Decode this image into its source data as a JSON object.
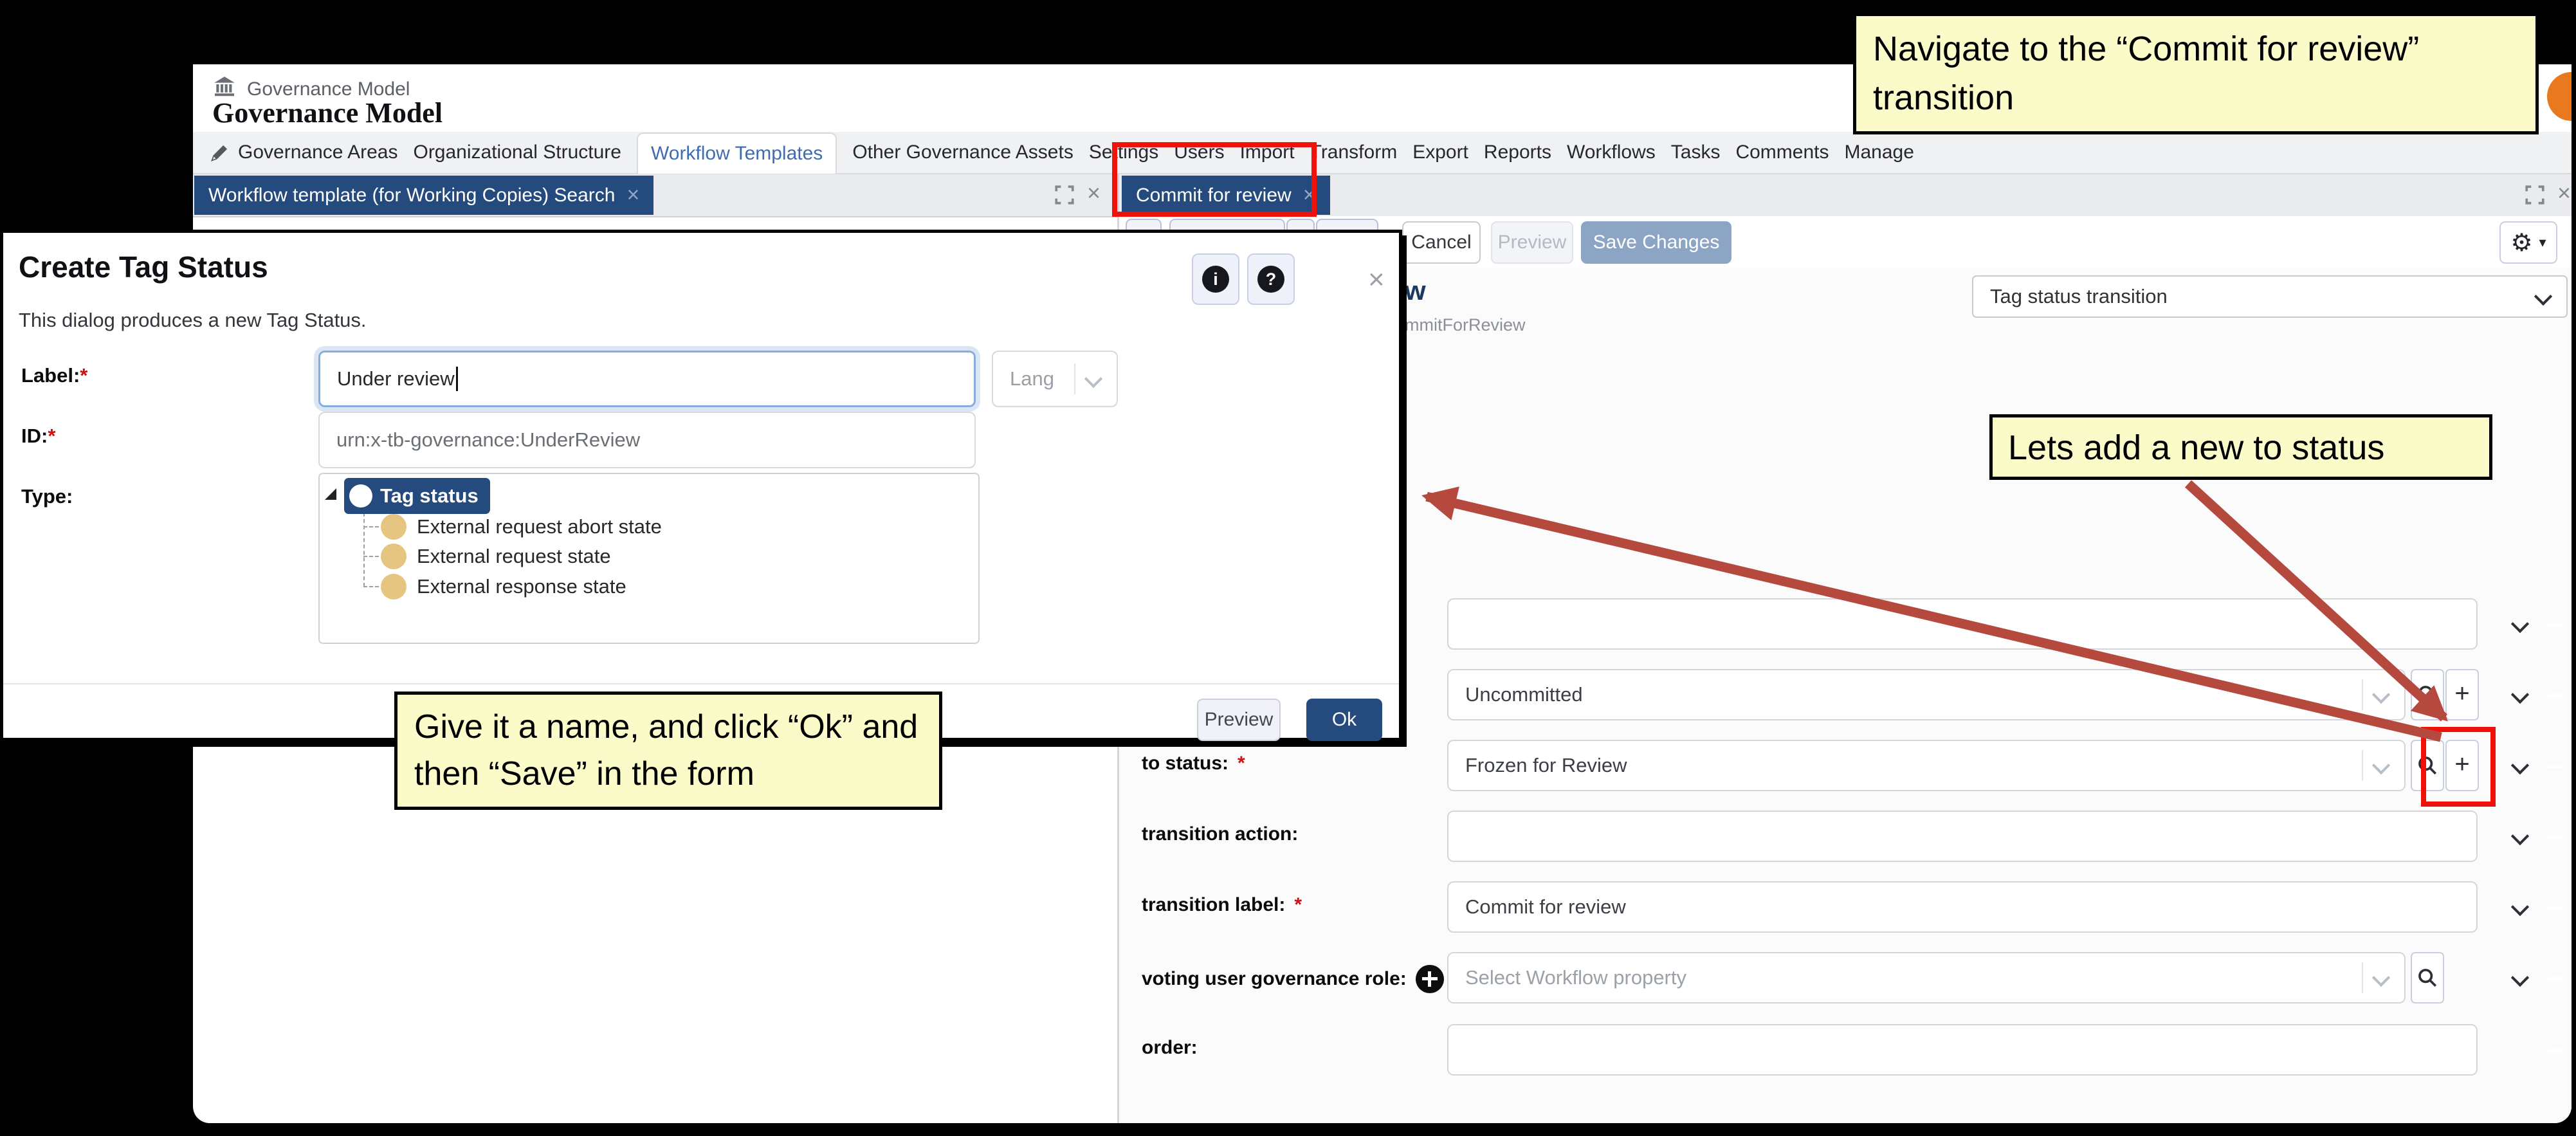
{
  "callouts": {
    "navigate_transition": "Navigate to the “Commit for review” transition",
    "add_new_to_status": "Lets add a new to status",
    "give_name": "Give it a name, and click “Ok” and then “Save” in the form"
  },
  "header": {
    "breadcrumb": "Governance Model",
    "title": "Governance Model"
  },
  "nav": {
    "active": "Workflow Templates",
    "items": [
      "Governance Areas",
      "Organizational Structure",
      "Workflow Templates",
      "Other Governance Assets",
      "Settings",
      "Users",
      "Import",
      "Transform",
      "Export",
      "Reports",
      "Workflows",
      "Tasks",
      "Comments",
      "Manage"
    ]
  },
  "tabs": {
    "left": "Workflow template (for Working Copies) Search",
    "right": "Commit for review",
    "close_glyph": "×"
  },
  "toolbar": {
    "cancel": "Cancel",
    "preview": "Preview",
    "save": "Save Changes"
  },
  "detail": {
    "title_fragment": "w",
    "id_fragment": "mmitForReview",
    "type_selector": "Tag status transition"
  },
  "form": {
    "rows": [
      {
        "label": "",
        "req": "",
        "value": "",
        "controls": [
          "collapse",
          "remove"
        ]
      },
      {
        "label": "",
        "req": "",
        "value": "Uncommitted",
        "controls": [
          "select",
          "search",
          "add",
          "collapse",
          "remove"
        ]
      },
      {
        "label": "to status:",
        "req": "*",
        "value": "Frozen for Review",
        "controls": [
          "select",
          "search",
          "add",
          "collapse",
          "remove"
        ],
        "highlighted": true
      },
      {
        "label": "transition action:",
        "req": "",
        "value": "",
        "controls": [
          "collapse",
          "remove"
        ]
      },
      {
        "label": "transition label:",
        "req": "*",
        "value": "Commit for review",
        "controls": [
          "collapse",
          "remove"
        ]
      },
      {
        "label": "voting user governance role:",
        "req": "",
        "value": "",
        "placeholder": "Select Workflow property",
        "controls": [
          "select",
          "search",
          "collapse",
          "remove"
        ],
        "label_add_icon": true
      },
      {
        "label": "order:",
        "req": "",
        "value": "",
        "controls": [
          "remove"
        ]
      }
    ]
  },
  "dialog": {
    "title": "Create Tag Status",
    "subtitle": "This dialog produces a new Tag Status.",
    "info_glyph": "i",
    "help_glyph": "?",
    "close_glyph": "×",
    "label_field": {
      "label": "Label:",
      "req": "*",
      "value": "Under review",
      "lang_button": "Lang"
    },
    "id_field": {
      "label": "ID:",
      "req": "*",
      "value": "urn:x-tb-governance:UnderReview"
    },
    "type_field": {
      "label": "Type:",
      "root": "Tag status",
      "children": [
        "External request abort state",
        "External request state",
        "External response state"
      ]
    },
    "buttons": {
      "preview": "Preview",
      "ok": "Ok"
    }
  },
  "icons": {
    "app": "bank-icon",
    "edit": "pencil-icon",
    "expand": "fullscreen-icon",
    "close": "close-icon",
    "settings": "gear-icon",
    "settings_glyph": "⚙",
    "dropdown_glyph": "▾",
    "info": "info-icon",
    "help": "help-icon",
    "search": "search-icon",
    "add": "plus-icon",
    "add_glyph": "+",
    "remove": "remove-circle-icon",
    "collapse": "chevron-down-icon"
  },
  "colors": {
    "tab_blue": "#254a7d",
    "callout_bg": "#fbfbca",
    "highlight_red": "#ee1208",
    "arrow_red": "#b5493e",
    "save_button": "#8ca5c5",
    "tree_node_gold": "#e5c57f",
    "avatar_orange": "#e8791f"
  }
}
